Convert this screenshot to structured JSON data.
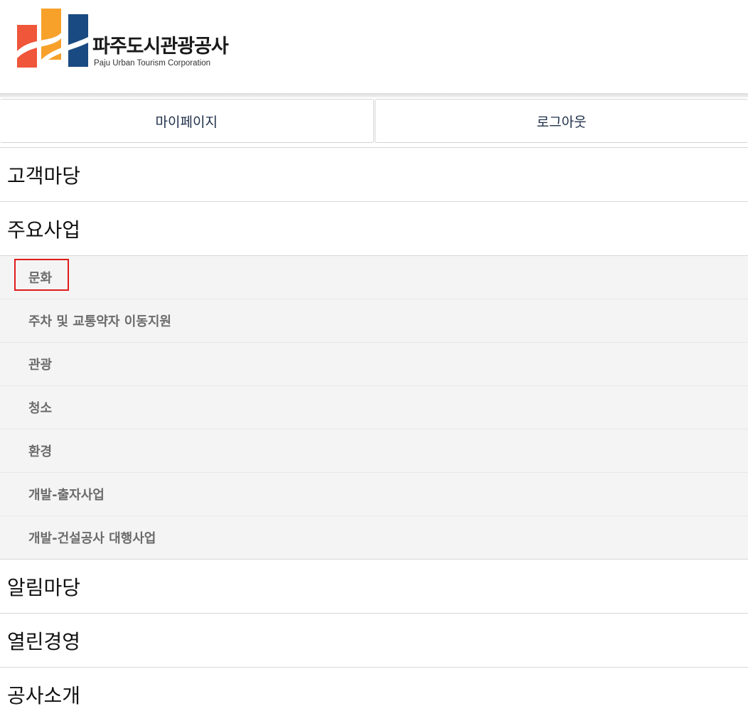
{
  "header": {
    "logo_kor": "파주도시관광공사",
    "logo_eng": "Paju Urban Tourism Corporation"
  },
  "top_buttons": {
    "mypage": "마이페이지",
    "logout": "로그아웃"
  },
  "menu": {
    "customer": "고객마당",
    "business": "주요사업",
    "business_sub": [
      "문화",
      "주차 및 교통약자 이동지원",
      "관광",
      "청소",
      "환경",
      "개발-출자사업",
      "개발-건설공사 대행사업"
    ],
    "notice": "알림마당",
    "management": "열린경영",
    "about": "공사소개"
  },
  "colors": {
    "logo_orange_red": "#f0563a",
    "logo_orange": "#f7a12b",
    "logo_navy": "#1a4a82",
    "highlight": "#e01b1b",
    "submenu_bg": "#f4f4f4"
  }
}
